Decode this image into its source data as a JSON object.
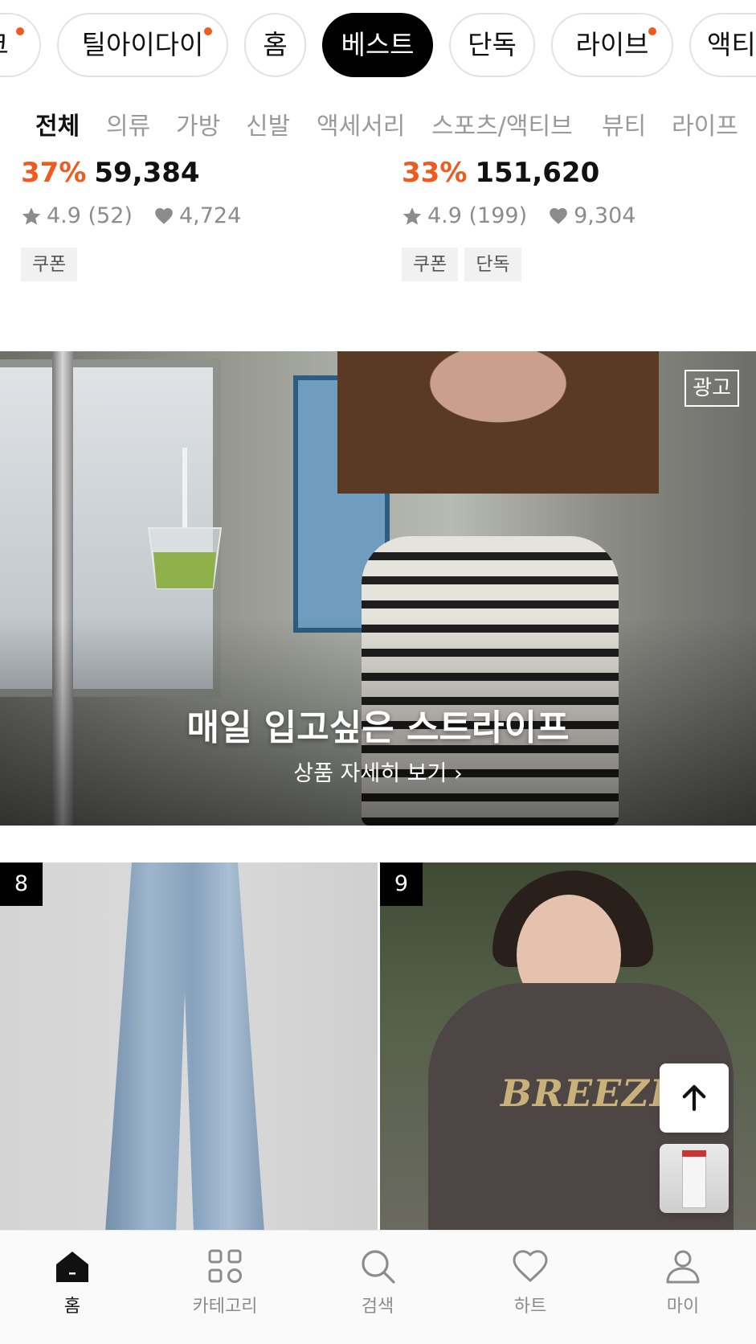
{
  "pill_tabs": [
    {
      "label": "크",
      "dot": true
    },
    {
      "label": "틸아이다이",
      "dot": true
    },
    {
      "label": "홈",
      "dot": false
    },
    {
      "label": "베스트",
      "dot": false,
      "active": true
    },
    {
      "label": "단독",
      "dot": false
    },
    {
      "label": "라이브",
      "dot": true
    },
    {
      "label": "액티",
      "dot": false
    }
  ],
  "categories": [
    "전체",
    "의류",
    "가방",
    "신발",
    "액세서리",
    "스포츠/액티브",
    "뷰티",
    "라이프"
  ],
  "products_top": [
    {
      "discount": "37%",
      "price": "59,384",
      "rating": "4.9 (52)",
      "hearts": "4,724",
      "tags": [
        "쿠폰"
      ]
    },
    {
      "discount": "33%",
      "price": "151,620",
      "rating": "4.9 (199)",
      "hearts": "9,304",
      "tags": [
        "쿠폰",
        "단독"
      ]
    }
  ],
  "banner": {
    "ad_badge": "광고",
    "title": "매일 입고싶은 스트라이프",
    "link": "상품 자세히 보기 ›"
  },
  "products_bottom": [
    {
      "rank": "8",
      "image": "wide-leg-jeans"
    },
    {
      "rank": "9",
      "image": "breeze-graphic-tee",
      "print": "BREEZE"
    }
  ],
  "bottom_nav": [
    {
      "label": "홈",
      "icon": "home-icon",
      "active": true
    },
    {
      "label": "카테고리",
      "icon": "category-grid-icon"
    },
    {
      "label": "검색",
      "icon": "search-icon"
    },
    {
      "label": "하트",
      "icon": "heart-icon"
    },
    {
      "label": "마이",
      "icon": "person-icon"
    }
  ],
  "colors": {
    "accent": "#f05a1e",
    "text": "#111111",
    "muted": "#8c8c8c"
  }
}
